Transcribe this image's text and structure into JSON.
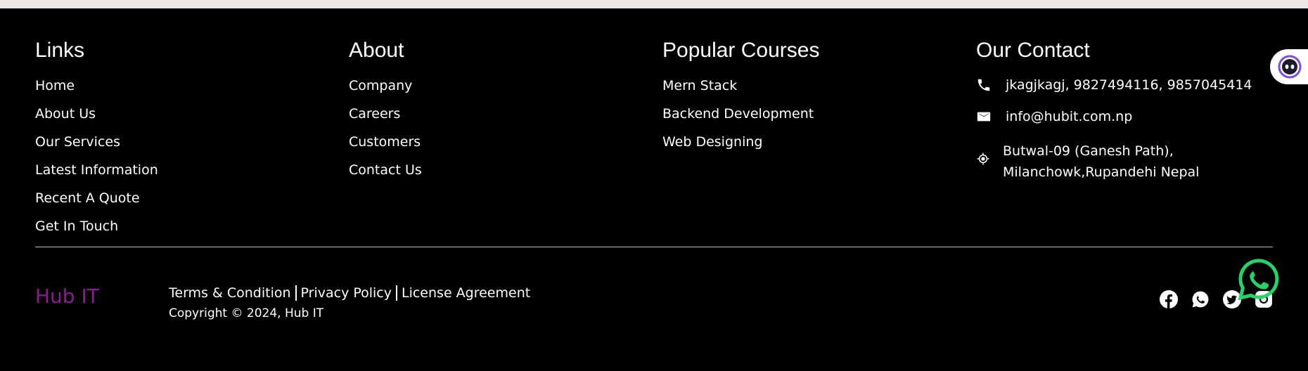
{
  "columns": {
    "links": {
      "title": "Links",
      "items": [
        "Home",
        "About Us",
        "Our Services",
        "Latest Information",
        "Recent A Quote",
        "Get In Touch"
      ]
    },
    "about": {
      "title": "About",
      "items": [
        "Company",
        "Careers",
        "Customers",
        "Contact Us"
      ]
    },
    "courses": {
      "title": "Popular Courses",
      "items": [
        "Mern Stack",
        "Backend Development",
        "Web Designing"
      ]
    },
    "contact": {
      "title": "Our Contact",
      "phone": "jkagjkagj, 9827494116, 9857045414",
      "email": "info@hubit.com.np",
      "address_line1": "Butwal-09 (Ganesh Path),",
      "address_line2": "Milanchowk,Rupandehi Nepal"
    }
  },
  "bottom": {
    "brand": "Hub IT",
    "legal_links": [
      "Terms & Condition",
      "Privacy Policy",
      "License Agreement"
    ],
    "copyright": "Copyright © 2024, Hub IT"
  },
  "icons": {
    "phone": "phone-icon",
    "email": "mail-icon",
    "address": "location-icon",
    "social": [
      "facebook-icon",
      "whatsapp-icon",
      "twitter-icon",
      "instagram-icon"
    ],
    "floating": "whatsapp-icon"
  },
  "colors": {
    "background": "#000000",
    "text": "#ffffff",
    "brand": "#8c1c8f",
    "whatsapp": "#25d366",
    "top_strip": "#eae8e6"
  }
}
